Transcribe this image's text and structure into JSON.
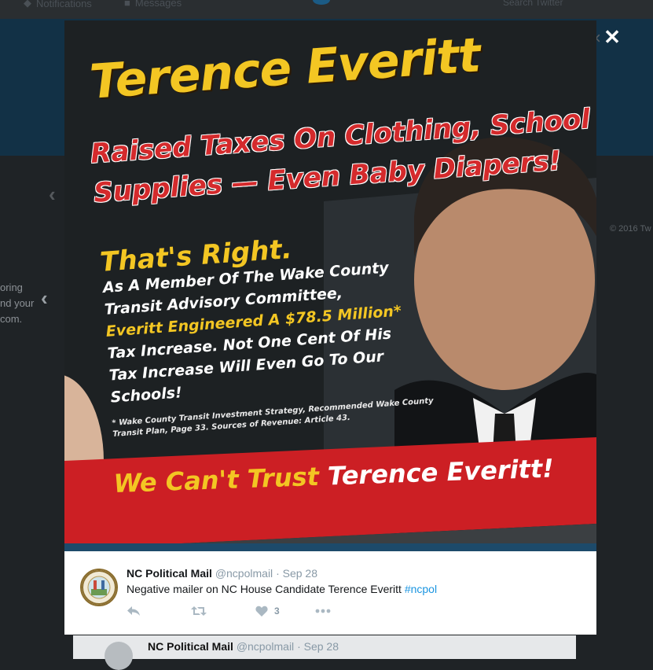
{
  "background": {
    "nav_notifications": "Notifications",
    "nav_messages": "Messages",
    "search_placeholder": "Search Twitter",
    "side_text": "oring\nnd your\ncom.",
    "copyright": "© 2016 Tw",
    "card_name": "NC Political Mail",
    "card_handle": "@ncpolmail",
    "card_date": "· Sep 28"
  },
  "flyer": {
    "headline": "Terence Everitt",
    "subhead_line1": "Raised Taxes On Clothing, School",
    "subhead_line2": "Supplies — Even Baby Diapers!",
    "thats_right": "That's Right.",
    "body_line1": "As A Member Of The Wake County",
    "body_line2": "Transit Advisory Committee,",
    "body_line3": "Everitt Engineered A $78.5 Million*",
    "body_line4": "Tax Increase. Not One Cent Of His",
    "body_line5": "Tax Increase Will Even Go To Our",
    "body_line6": "Schools!",
    "footnote_line1": "* Wake County Transit Investment Strategy, Recommended Wake County",
    "footnote_line2": "Transit Plan, Page 33. Sources of Revenue: Article 43.",
    "banner_part1": "We Can't Trust ",
    "banner_part2": "Terence Everitt!"
  },
  "tweet": {
    "name": "NC Political Mail",
    "handle": "@ncpolmail",
    "date": "· Sep 28",
    "text": "Negative mailer on NC House Candidate Terence Everitt ",
    "hashtag": "#ncpol",
    "like_count": "3"
  },
  "icons": {
    "close": "close-icon",
    "reply": "reply-icon",
    "retweet": "retweet-icon",
    "like": "heart-icon",
    "more": "more-icon"
  },
  "colors": {
    "flyer_yellow": "#f3c623",
    "flyer_red": "#d42a2c",
    "link_blue": "#1b95e0",
    "header_blue": "#123146"
  }
}
